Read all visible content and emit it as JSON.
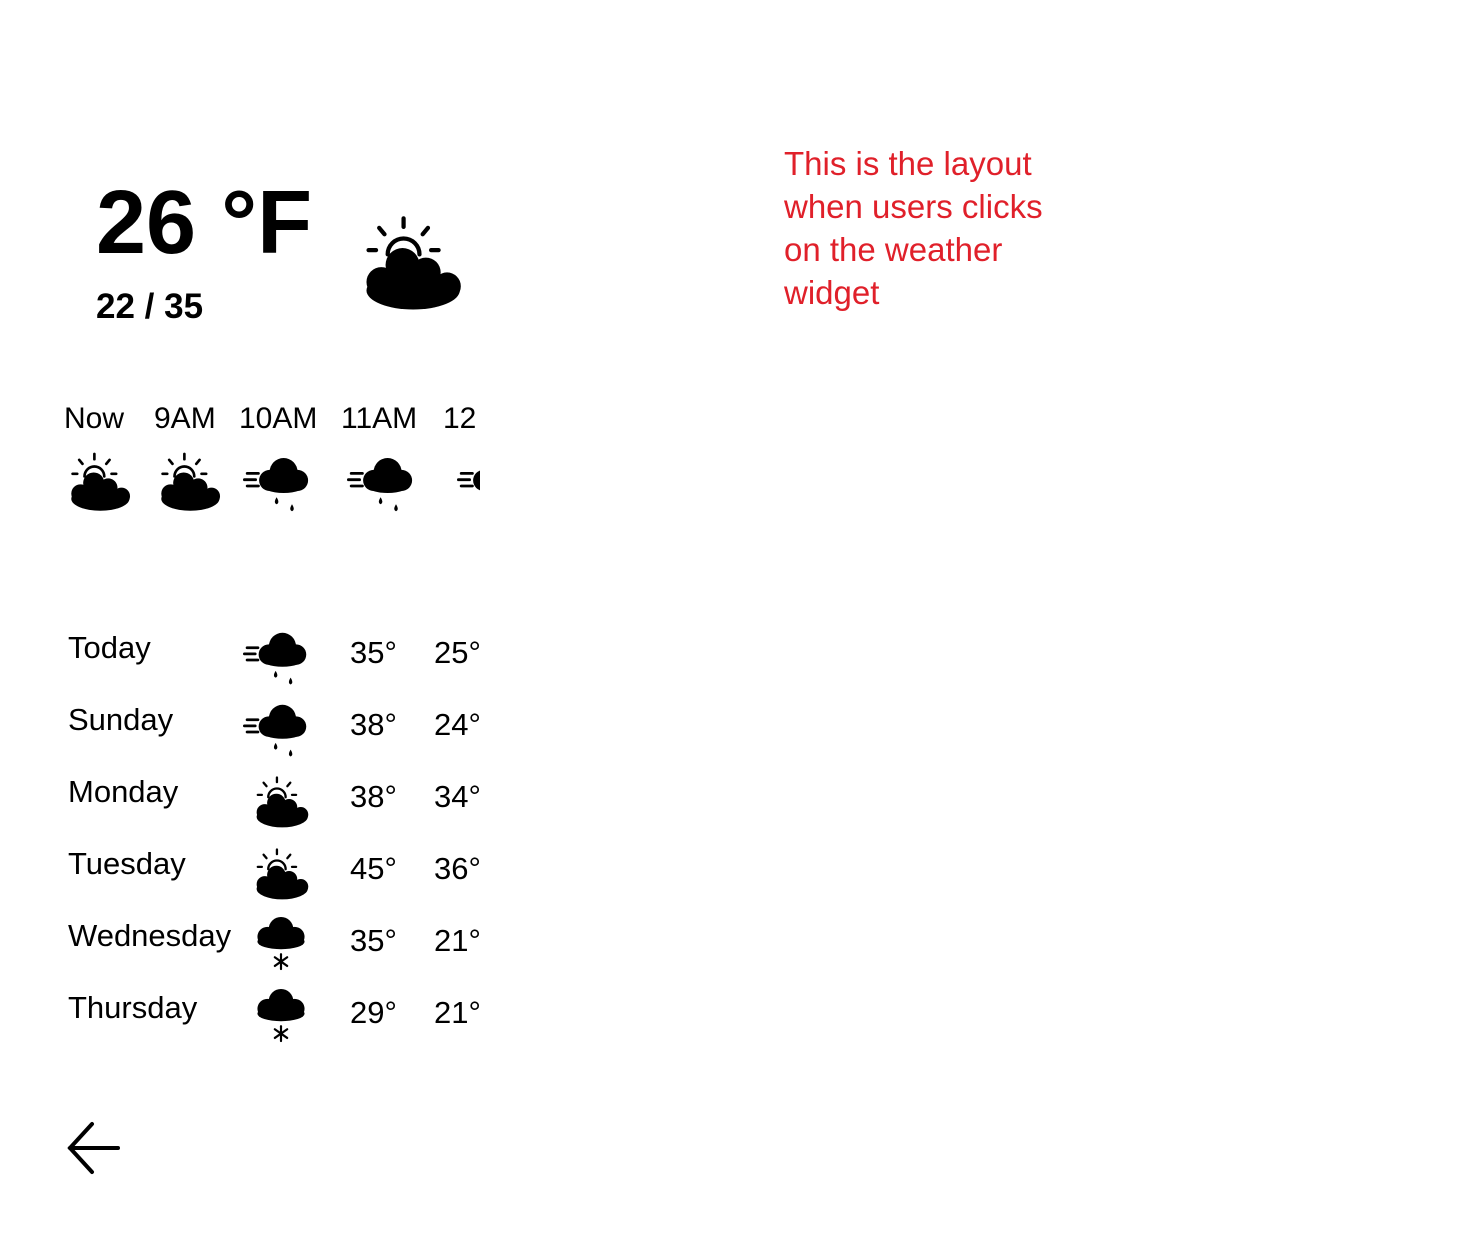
{
  "current": {
    "temperature": "26 °F",
    "range": "22 / 35",
    "icon": "partly-cloudy-icon"
  },
  "hourly": [
    {
      "time": "Now",
      "icon": "partly-cloudy-icon"
    },
    {
      "time": "9AM",
      "icon": "partly-cloudy-icon"
    },
    {
      "time": "10AM",
      "icon": "windy-rain-icon"
    },
    {
      "time": "11AM",
      "icon": "windy-rain-icon"
    },
    {
      "time": "12",
      "icon": "windy-rain-icon"
    }
  ],
  "daily": [
    {
      "day": "Today",
      "icon": "windy-rain-icon",
      "high": "35°",
      "low": "25°"
    },
    {
      "day": "Sunday",
      "icon": "windy-rain-icon",
      "high": "38°",
      "low": "24°"
    },
    {
      "day": "Monday",
      "icon": "partly-cloudy-icon",
      "high": "38°",
      "low": "34°"
    },
    {
      "day": "Tuesday",
      "icon": "partly-cloudy-icon",
      "high": "45°",
      "low": "36°"
    },
    {
      "day": "Wednesday",
      "icon": "snow-icon",
      "high": "35°",
      "low": "21°"
    },
    {
      "day": "Thursday",
      "icon": "snow-icon",
      "high": "29°",
      "low": "21°"
    }
  ],
  "annotation": {
    "lines": [
      "This is the layout",
      "when users clicks",
      "on the weather",
      "widget"
    ],
    "color": "#e0202a"
  },
  "navigation": {
    "back_icon": "back-arrow-icon"
  }
}
